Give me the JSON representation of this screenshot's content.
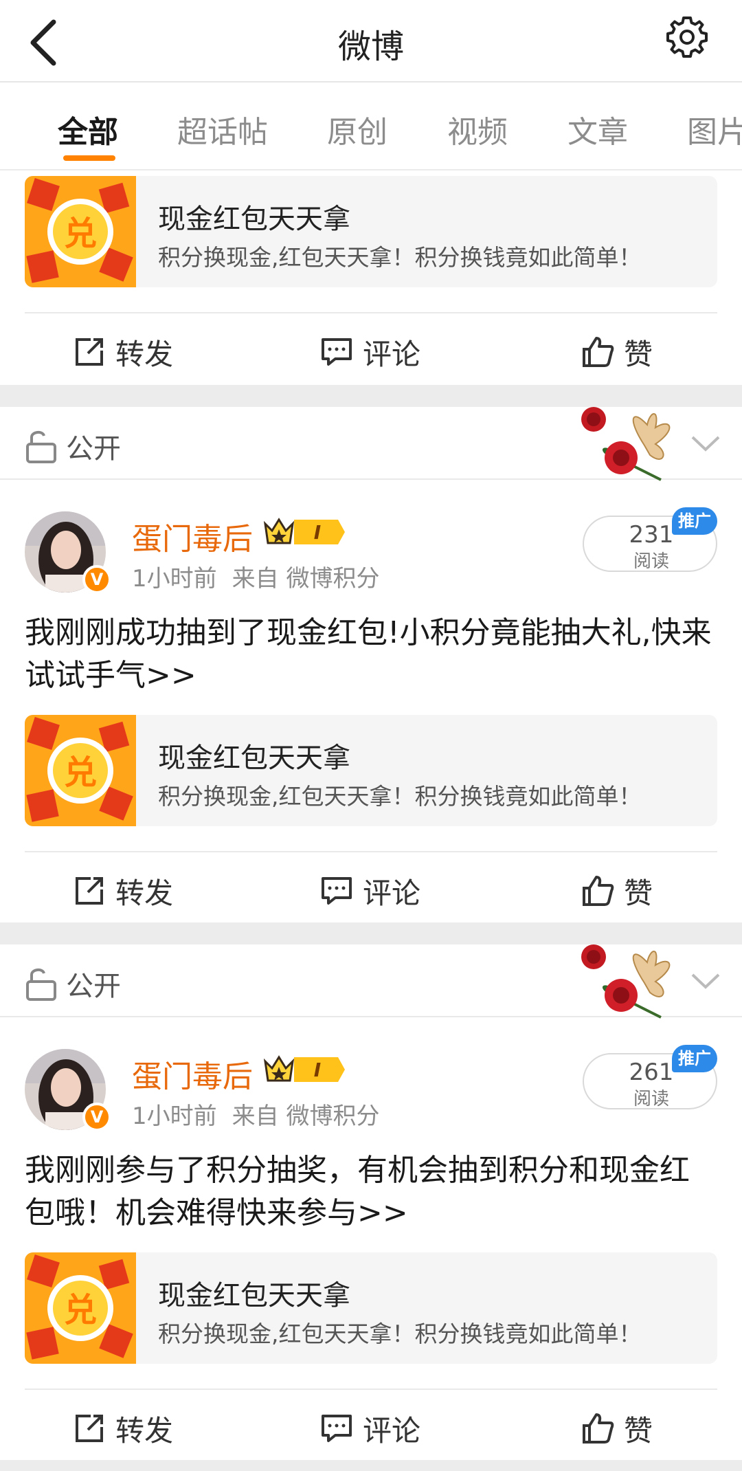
{
  "header": {
    "title": "微博"
  },
  "tabs": [
    "全部",
    "超话帖",
    "原创",
    "视频",
    "文章",
    "图片"
  ],
  "actions": {
    "repost": "转发",
    "comment": "评论",
    "like": "赞"
  },
  "link_card": {
    "title": "现金红包天天拿",
    "desc": "积分换现金,红包天天拿！积分换钱竟如此简单！",
    "thumb_char": "兑"
  },
  "colors": {
    "accent": "#ff8200",
    "username": "#e8690b",
    "promo_badge": "#2d8ae8"
  },
  "posts": [
    {
      "visibility": "公开",
      "username": "蛋门毒后",
      "level": "I",
      "time": "1小时前",
      "source": "来自 微博积分",
      "reads": "231",
      "reads_label": "阅读",
      "promo": "推广",
      "text": "我刚刚成功抽到了现金红包!小积分竟能抽大礼,快来试试手气>>"
    },
    {
      "visibility": "公开",
      "username": "蛋门毒后",
      "level": "I",
      "time": "1小时前",
      "source": "来自 微博积分",
      "reads": "261",
      "reads_label": "阅读",
      "promo": "推广",
      "text": "我刚刚参与了积分抽奖，有机会抽到积分和现金红包哦！机会难得快来参与>>"
    }
  ]
}
